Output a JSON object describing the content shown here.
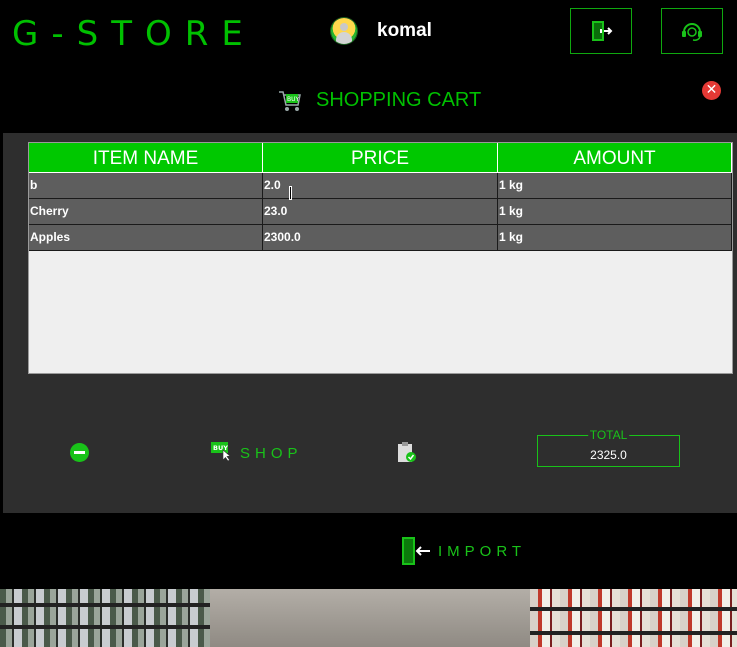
{
  "app": {
    "logo": "G-STORE"
  },
  "header": {
    "username": "komal"
  },
  "cart": {
    "title": "SHOPPING CART"
  },
  "table": {
    "headers": [
      "ITEM NAME",
      "PRICE",
      "AMOUNT"
    ],
    "rows": [
      [
        "b",
        "2.0",
        "1 kg"
      ],
      [
        "Cherry",
        "23.0",
        "1 kg"
      ],
      [
        "Apples",
        "2300.0",
        "1 kg"
      ]
    ]
  },
  "actions": {
    "shop_label": "SHOP",
    "total_label": "TOTAL",
    "total_value": "2325.0"
  },
  "footer": {
    "import_label": "IMPORT"
  },
  "icons": {
    "user": "avatar-icon",
    "logout": "logout-icon",
    "support": "support-icon",
    "cart": "cart-icon",
    "close": "close-icon",
    "remove": "minus-circle-icon",
    "shop": "buy-icon",
    "clear": "clipboard-icon",
    "import": "import-icon"
  },
  "colors": {
    "accent": "#00c000",
    "header_bg": "#00c800",
    "close": "#e53935",
    "panel": "#2e2e2e"
  }
}
